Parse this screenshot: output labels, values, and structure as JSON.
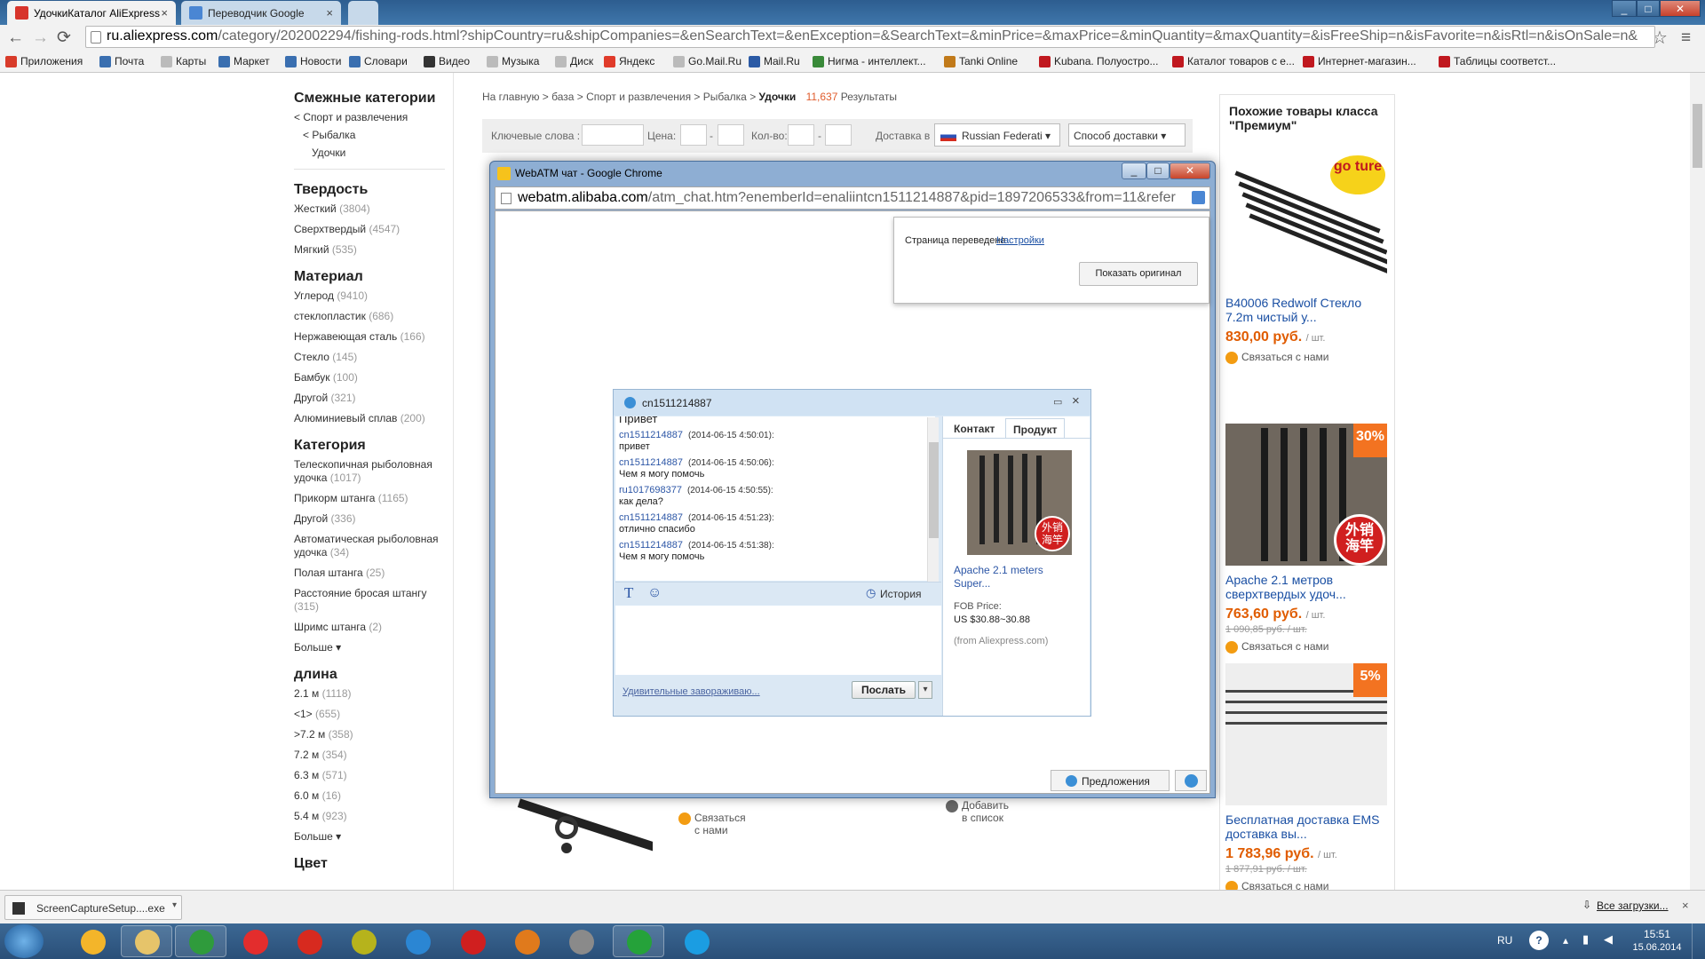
{
  "tabs": [
    {
      "title": "УдочкиКаталог AliExpress",
      "active": true
    },
    {
      "title": "Переводчик Google",
      "active": false
    }
  ],
  "window_buttons": {
    "minimize": "_",
    "maximize": "□",
    "close": "✕"
  },
  "toolbar": {
    "back": "←",
    "forward": "→",
    "reload": "⟳",
    "url_host": "ru.aliexpress.com",
    "url_path": "/category/202002294/fishing-rods.html?shipCountry=ru&shipCompanies=&enSearchText=&enException=&SearchText=&minPrice=&maxPrice=&minQuantity=&maxQuantity=&isFreeShip=n&isFavorite=n&isRtl=n&isOnSale=n&",
    "star": "☆",
    "menu": "≡"
  },
  "bookmarks": [
    {
      "label": "Приложения",
      "icon_color": "#d83b2a"
    },
    {
      "label": "Почта",
      "icon_color": "#3a6fb0"
    },
    {
      "label": "Карты",
      "icon_color": "#bbbbbb"
    },
    {
      "label": "Маркет",
      "icon_color": "#3a6fb0"
    },
    {
      "label": "Новости",
      "icon_color": "#3a6fb0"
    },
    {
      "label": "Словари",
      "icon_color": "#3a6fb0"
    },
    {
      "label": "Видео",
      "icon_color": "#333333"
    },
    {
      "label": "Музыка",
      "icon_color": "#bbbbbb"
    },
    {
      "label": "Диск",
      "icon_color": "#bbbbbb"
    },
    {
      "label": "Яндекс",
      "icon_color": "#e03b2a"
    },
    {
      "label": "Go.Mail.Ru",
      "icon_color": "#bbbbbb"
    },
    {
      "label": "Mail.Ru",
      "icon_color": "#2b5aa5"
    },
    {
      "label": "Нигма - интеллект...",
      "icon_color": "#3a8a3a"
    },
    {
      "label": "Tanki Online",
      "icon_color": "#c17a1a"
    },
    {
      "label": "Kubana. Полуостро...",
      "icon_color": "#c0181f"
    },
    {
      "label": "Каталог товаров с е...",
      "icon_color": "#c0181f"
    },
    {
      "label": "Интернет-магазин...",
      "icon_color": "#c0181f"
    },
    {
      "label": "Таблицы соответст...",
      "icon_color": "#c0181f"
    }
  ],
  "sidebar": {
    "related_title": "Смежные категории",
    "related": [
      "< Спорт и развлечения",
      "< Рыбалка",
      "Удочки"
    ],
    "groups": [
      {
        "title": "Твердость",
        "items": [
          {
            "label": "Жесткий",
            "count": "(3804)"
          },
          {
            "label": "Сверхтвердый",
            "count": "(4547)"
          },
          {
            "label": "Мягкий",
            "count": "(535)"
          }
        ]
      },
      {
        "title": "Материал",
        "items": [
          {
            "label": "Углерод",
            "count": "(9410)"
          },
          {
            "label": "стеклопластик",
            "count": "(686)"
          },
          {
            "label": "Нержавеющая сталь",
            "count": "(166)"
          },
          {
            "label": "Стекло",
            "count": "(145)"
          },
          {
            "label": "Бамбук",
            "count": "(100)"
          },
          {
            "label": "Другой",
            "count": "(321)"
          },
          {
            "label": "Алюминиевый сплав",
            "count": "(200)"
          }
        ]
      },
      {
        "title": "Категория",
        "items": [
          {
            "label": "Телескопичная рыболовная удочка",
            "count": "(1017)"
          },
          {
            "label": "Прикорм штанга",
            "count": "(1165)"
          },
          {
            "label": "Другой",
            "count": "(336)"
          },
          {
            "label": "Автоматическая рыболовная удочка",
            "count": "(34)"
          },
          {
            "label": "Полая штанга",
            "count": "(25)"
          },
          {
            "label": "Расстояние бросая штангу",
            "count": "(315)"
          },
          {
            "label": "Шримс штанга",
            "count": "(2)"
          },
          {
            "label": "Больше ▾",
            "count": ""
          }
        ]
      },
      {
        "title": "длина",
        "items": [
          {
            "label": "2.1 м",
            "count": "(1118)"
          },
          {
            "label": "<1>",
            "count": "(655)"
          },
          {
            "label": ">7.2 м",
            "count": "(358)"
          },
          {
            "label": "7.2 м",
            "count": "(354)"
          },
          {
            "label": "6.3 м",
            "count": "(571)"
          },
          {
            "label": "6.0 м",
            "count": "(16)"
          },
          {
            "label": "5.4 м",
            "count": "(923)"
          },
          {
            "label": "Больше ▾",
            "count": ""
          }
        ]
      }
    ],
    "next_title": "Цвет"
  },
  "breadcrumb": {
    "path": "На главную > база > Спорт и развлечения > Рыбалка > ",
    "current": "Удочки",
    "count": "11,637",
    "results": "Результаты"
  },
  "filter": {
    "keywords": "Ключевые слова :",
    "price": "Цена:",
    "qty": "Кол-во:",
    "dash": "-",
    "delivery": "Доставка в",
    "country": "Russian Federati ▾",
    "ship_method": "Способ доставки ▾"
  },
  "right": {
    "title": "Похожие товары класса \"Премиум\"",
    "products": [
      {
        "title": "B40006 Redwolf Стекло 7.2m чистый у...",
        "price": "830,00 руб.",
        "unit": "/ шт.",
        "old": "",
        "contact": "Связаться с нами",
        "badge": "",
        "logo": "go ture"
      },
      {
        "title": "Apache 2.1 метров сверхтвердых удоч...",
        "price": "763,60 руб.",
        "unit": "/ шт.",
        "old": "1 090,85 руб. / шт.",
        "contact": "Связаться с нами",
        "badge": "30%",
        "logo": "外销 海竿"
      },
      {
        "title": "Бесплатная доставка EMS доставка вы...",
        "price": "1 783,96 руб.",
        "unit": "/ шт.",
        "old": "1 877,91 руб. / шт.",
        "contact": "Связаться с нами",
        "badge": "5%",
        "logo": ""
      }
    ]
  },
  "behind": {
    "contact": "Связаться с нами",
    "add": "Добавить в список"
  },
  "popup": {
    "title": "WebATM чат - Google Chrome",
    "addr_host": "webatm.alibaba.com",
    "addr_path": "/atm_chat.htm?enemberId=enaliintcn1511214887&pid=1897206533&from=11&refer",
    "translate_text": "Страница переведена",
    "translate_settings": "Настройки",
    "translate_button": "Показать оригинал",
    "chat_user": "cn1511214887",
    "messages": [
      {
        "who": "",
        "time": "",
        "text": "Привет"
      },
      {
        "who": "cn1511214887",
        "time": "(2014-06-15 4:50:01):",
        "text": "привет"
      },
      {
        "who": "cn1511214887",
        "time": "(2014-06-15 4:50:06):",
        "text": "Чем я могу помочь"
      },
      {
        "who": "ru1017698377",
        "time": "(2014-06-15 4:50:55):",
        "text": "как дела?"
      },
      {
        "who": "cn1511214887",
        "time": "(2014-06-15 4:51:23):",
        "text": "отлично спасибо"
      },
      {
        "who": "cn1511214887",
        "time": "(2014-06-15 4:51:38):",
        "text": "Чем я могу помочь"
      }
    ],
    "history": "История",
    "footer_link": "Удивительные завораживаю...",
    "send": "Послать",
    "tab_contact": "Контакт",
    "tab_product": "Продукт",
    "product_name": "Apache 2.1 meters Super...",
    "product_logo": "外销 海竿",
    "fob_label": "FOB Price:",
    "fob_value": "US $30.88~30.88",
    "source": "(from Aliexpress.com)",
    "offers": "Предложения"
  },
  "download": {
    "file": "ScreenCaptureSetup....exe",
    "all": "Все загрузки..."
  },
  "taskbar": {
    "lang": "RU",
    "time": "15:51",
    "date": "15.06.2014",
    "apps": [
      {
        "name": "maxthon",
        "color": "#f3b52a",
        "open": false
      },
      {
        "name": "explorer",
        "color": "#e6c46a",
        "open": true
      },
      {
        "name": "chrome",
        "color": "#2f9b3c",
        "open": true
      },
      {
        "name": "yandex",
        "color": "#e32d2d",
        "open": false
      },
      {
        "name": "yandex-browser",
        "color": "#d72a1f",
        "open": false
      },
      {
        "name": "app",
        "color": "#b6b31c",
        "open": false
      },
      {
        "name": "ie",
        "color": "#2b86d3",
        "open": false
      },
      {
        "name": "opera",
        "color": "#d01f1f",
        "open": false
      },
      {
        "name": "firefox",
        "color": "#e07a1c",
        "open": false
      },
      {
        "name": "tool",
        "color": "#8a8a8a",
        "open": false
      },
      {
        "name": "mail",
        "color": "#25a23a",
        "open": true
      },
      {
        "name": "skype",
        "color": "#1b9de2",
        "open": false
      }
    ]
  }
}
